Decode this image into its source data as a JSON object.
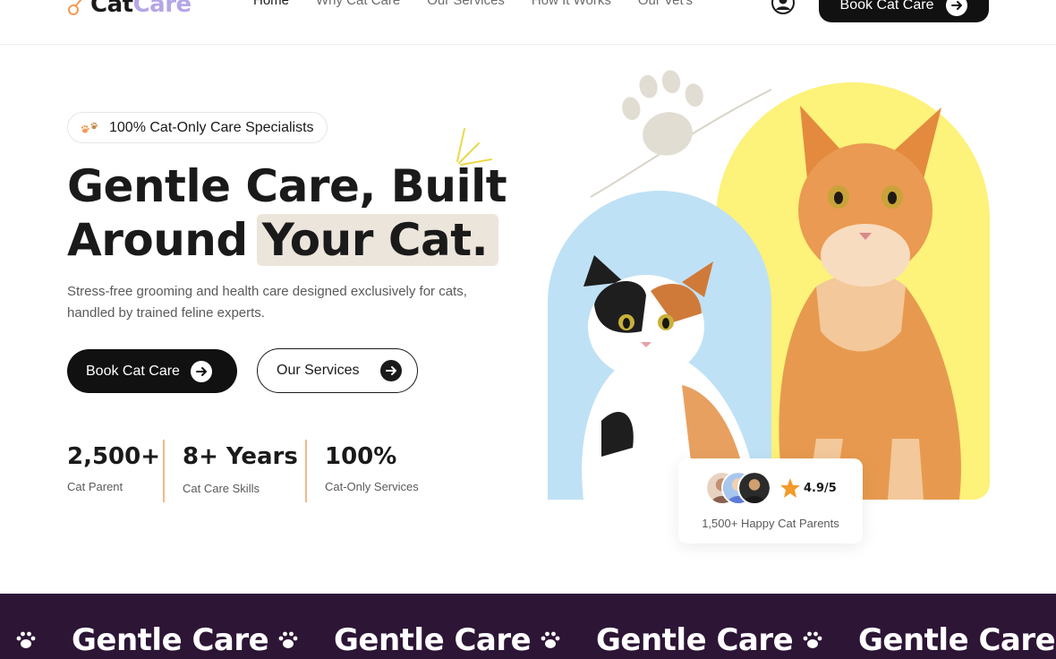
{
  "brand": {
    "name_part1": "Cat",
    "name_part2": "Care"
  },
  "nav": {
    "items": [
      {
        "label": "Home"
      },
      {
        "label": "Why Cat Care"
      },
      {
        "label": "Our Services"
      },
      {
        "label": "How It Works"
      },
      {
        "label": "Our Vet's"
      }
    ]
  },
  "header": {
    "cta_label": "Book Cat Care"
  },
  "hero": {
    "badge": "100% Cat-Only Care Specialists",
    "title_line1": "Gentle Care, Built",
    "title_line2_a": "Around",
    "title_line2_b": "Your Cat.",
    "subtitle": "Stress-free grooming and health care designed exclusively for cats, handled by trained feline experts.",
    "primary_cta": "Book Cat Care",
    "secondary_cta": "Our Services"
  },
  "stats": [
    {
      "value": "2,500+",
      "label": "Cat Parent"
    },
    {
      "value": "8+ Years",
      "label": "Cat Care Skills"
    },
    {
      "value": "100%",
      "label": "Cat-Only Services"
    }
  ],
  "rating": {
    "value": "4.9/5",
    "label": "1,500+ Happy Cat Parents"
  },
  "marquee": {
    "items": [
      "Gentle Care",
      "Gentle Care",
      "Gentle Care",
      "Gentle Care"
    ]
  },
  "colors": {
    "accent_yellow": "#fdf27a",
    "accent_blue": "#bfe1f5",
    "marquee_bg": "#2d1536",
    "highlight": "#ece5dc",
    "divider": "#f2b98a"
  }
}
